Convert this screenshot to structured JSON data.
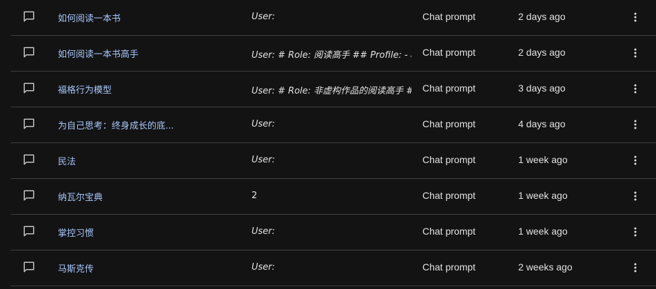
{
  "table": {
    "rows": [
      {
        "name": "如何阅读一本书",
        "description": "User:",
        "type": "Chat prompt",
        "updated": "2 days ago"
      },
      {
        "name": "如何阅读一本书高手",
        "description": "User: # Role: 阅读高手 ## Profile: - a",
        "type": "Chat prompt",
        "updated": "2 days ago"
      },
      {
        "name": "福格行为模型",
        "description": "User: # Role: 非虚构作品的阅读高手 #",
        "type": "Chat prompt",
        "updated": "3 days ago"
      },
      {
        "name": "为自己思考：终身成长的底...",
        "description": "User:",
        "type": "Chat prompt",
        "updated": "4 days ago"
      },
      {
        "name": "民法",
        "description": "User:",
        "type": "Chat prompt",
        "updated": "1 week ago"
      },
      {
        "name": "纳瓦尔宝典",
        "description": "2",
        "type": "Chat prompt",
        "updated": "1 week ago"
      },
      {
        "name": "掌控习惯",
        "description": "User:",
        "type": "Chat prompt",
        "updated": "1 week ago"
      },
      {
        "name": "马斯克传",
        "description": "User:",
        "type": "Chat prompt",
        "updated": "2 weeks ago"
      }
    ]
  },
  "icons": {
    "row_icon": "chat-bubble-icon",
    "menu_icon": "more-vert-icon"
  },
  "colors": {
    "background": "#131314",
    "link": "#a8c7fa",
    "text": "#e3e3e3",
    "divider": "#3c4043"
  }
}
